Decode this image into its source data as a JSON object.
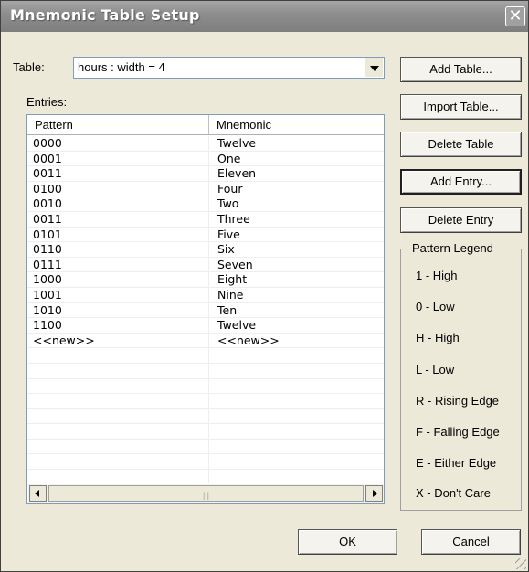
{
  "window": {
    "title": "Mnemonic Table Setup"
  },
  "table_select": {
    "label": "Table:",
    "value": "hours : width = 4"
  },
  "entries": {
    "label": "Entries:",
    "columns": [
      "Pattern",
      "Mnemonic"
    ],
    "rows": [
      [
        "0000",
        "Twelve"
      ],
      [
        "0001",
        "One"
      ],
      [
        "0011",
        "Eleven"
      ],
      [
        "0100",
        "Four"
      ],
      [
        "0010",
        "Two"
      ],
      [
        "0011",
        "Three"
      ],
      [
        "0101",
        "Five"
      ],
      [
        "0110",
        "Six"
      ],
      [
        "0111",
        "Seven"
      ],
      [
        "1000",
        "Eight"
      ],
      [
        "1001",
        "Nine"
      ],
      [
        "1010",
        "Ten"
      ],
      [
        "1100",
        "Twelve"
      ],
      [
        "<<new>>",
        "<<new>>"
      ]
    ]
  },
  "buttons": {
    "add_table": "Add Table...",
    "import_table": "Import Table...",
    "delete_table": "Delete Table",
    "add_entry": "Add Entry...",
    "delete_entry": "Delete Entry",
    "ok": "OK",
    "cancel": "Cancel"
  },
  "pattern_legend": {
    "title": "Pattern Legend",
    "items": [
      "1 - High",
      "0 - Low",
      "H - High",
      "L - Low",
      "R - Rising Edge",
      "F - Falling Edge",
      "E - Either Edge",
      "X - Don't Care"
    ]
  }
}
